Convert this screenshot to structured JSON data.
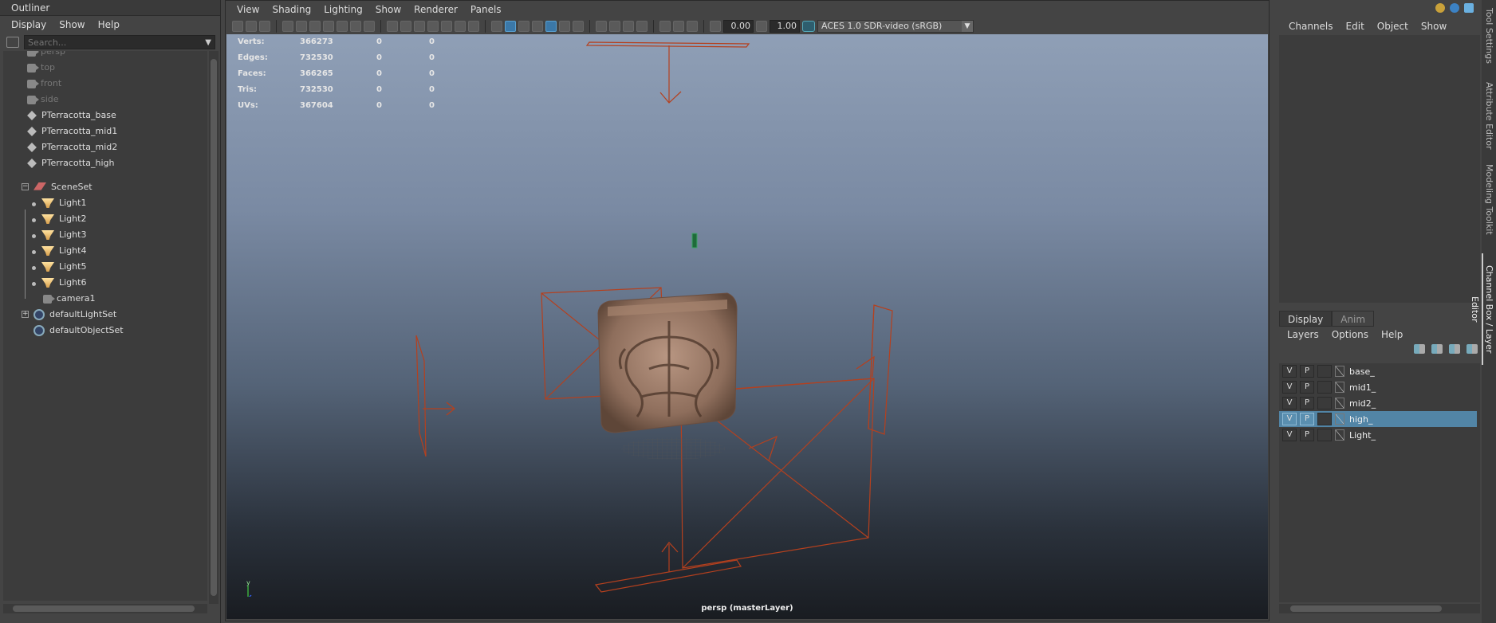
{
  "outliner": {
    "title": "Outliner",
    "menu": [
      "Display",
      "Show",
      "Help"
    ],
    "search_placeholder": "Search...",
    "nodes": [
      {
        "label": "persp",
        "type": "camera",
        "dim": true
      },
      {
        "label": "top",
        "type": "camera",
        "dim": true
      },
      {
        "label": "front",
        "type": "camera",
        "dim": true
      },
      {
        "label": "side",
        "type": "camera",
        "dim": true
      },
      {
        "label": "PTerracotta_base",
        "type": "mesh"
      },
      {
        "label": "PTerracotta_mid1",
        "type": "mesh"
      },
      {
        "label": "PTerracotta_mid2",
        "type": "mesh"
      },
      {
        "label": "PTerracotta_high",
        "type": "mesh"
      },
      {
        "label": "SceneSet",
        "type": "scene"
      },
      {
        "label": "Light1",
        "type": "light"
      },
      {
        "label": "Light2",
        "type": "light"
      },
      {
        "label": "Light3",
        "type": "light"
      },
      {
        "label": "Light4",
        "type": "light"
      },
      {
        "label": "Light5",
        "type": "light"
      },
      {
        "label": "Light6",
        "type": "light"
      },
      {
        "label": "camera1",
        "type": "camera"
      },
      {
        "label": "defaultLightSet",
        "type": "set"
      },
      {
        "label": "defaultObjectSet",
        "type": "set"
      }
    ]
  },
  "viewport": {
    "menu": [
      "View",
      "Shading",
      "Lighting",
      "Show",
      "Renderer",
      "Panels"
    ],
    "exposure": "0.00",
    "gamma": "1.00",
    "color_management": "ACES 1.0 SDR-video (sRGB)",
    "hud": [
      {
        "label": "Verts:",
        "a": "366273",
        "b": "0",
        "c": "0"
      },
      {
        "label": "Edges:",
        "a": "732530",
        "b": "0",
        "c": "0"
      },
      {
        "label": "Faces:",
        "a": "366265",
        "b": "0",
        "c": "0"
      },
      {
        "label": "Tris:",
        "a": "732530",
        "b": "0",
        "c": "0"
      },
      {
        "label": "UVs:",
        "a": "367604",
        "b": "0",
        "c": "0"
      }
    ],
    "camera_label": "persp (masterLayer)",
    "axis": {
      "y": "y",
      "x": "x"
    },
    "colors": {
      "light_wire": "#b5401e",
      "terracotta": "#9a7a66"
    }
  },
  "channel_box": {
    "menu": [
      "Channels",
      "Edit",
      "Object",
      "Show"
    ]
  },
  "layer_editor": {
    "tabs": [
      "Display",
      "Anim"
    ],
    "menu": [
      "Layers",
      "Options",
      "Help"
    ],
    "layers": [
      {
        "v": "V",
        "p": "P",
        "name": "base_",
        "selected": false
      },
      {
        "v": "V",
        "p": "P",
        "name": "mid1_",
        "selected": false
      },
      {
        "v": "V",
        "p": "P",
        "name": "mid2_",
        "selected": false
      },
      {
        "v": "V",
        "p": "P",
        "name": "high_",
        "selected": true
      },
      {
        "v": "V",
        "p": "P",
        "name": "Light_",
        "selected": false
      }
    ]
  },
  "side_tabs": [
    "Tool Settings",
    "Attribute Editor",
    "Modeling Toolkit",
    "Channel Box / Layer Editor"
  ]
}
